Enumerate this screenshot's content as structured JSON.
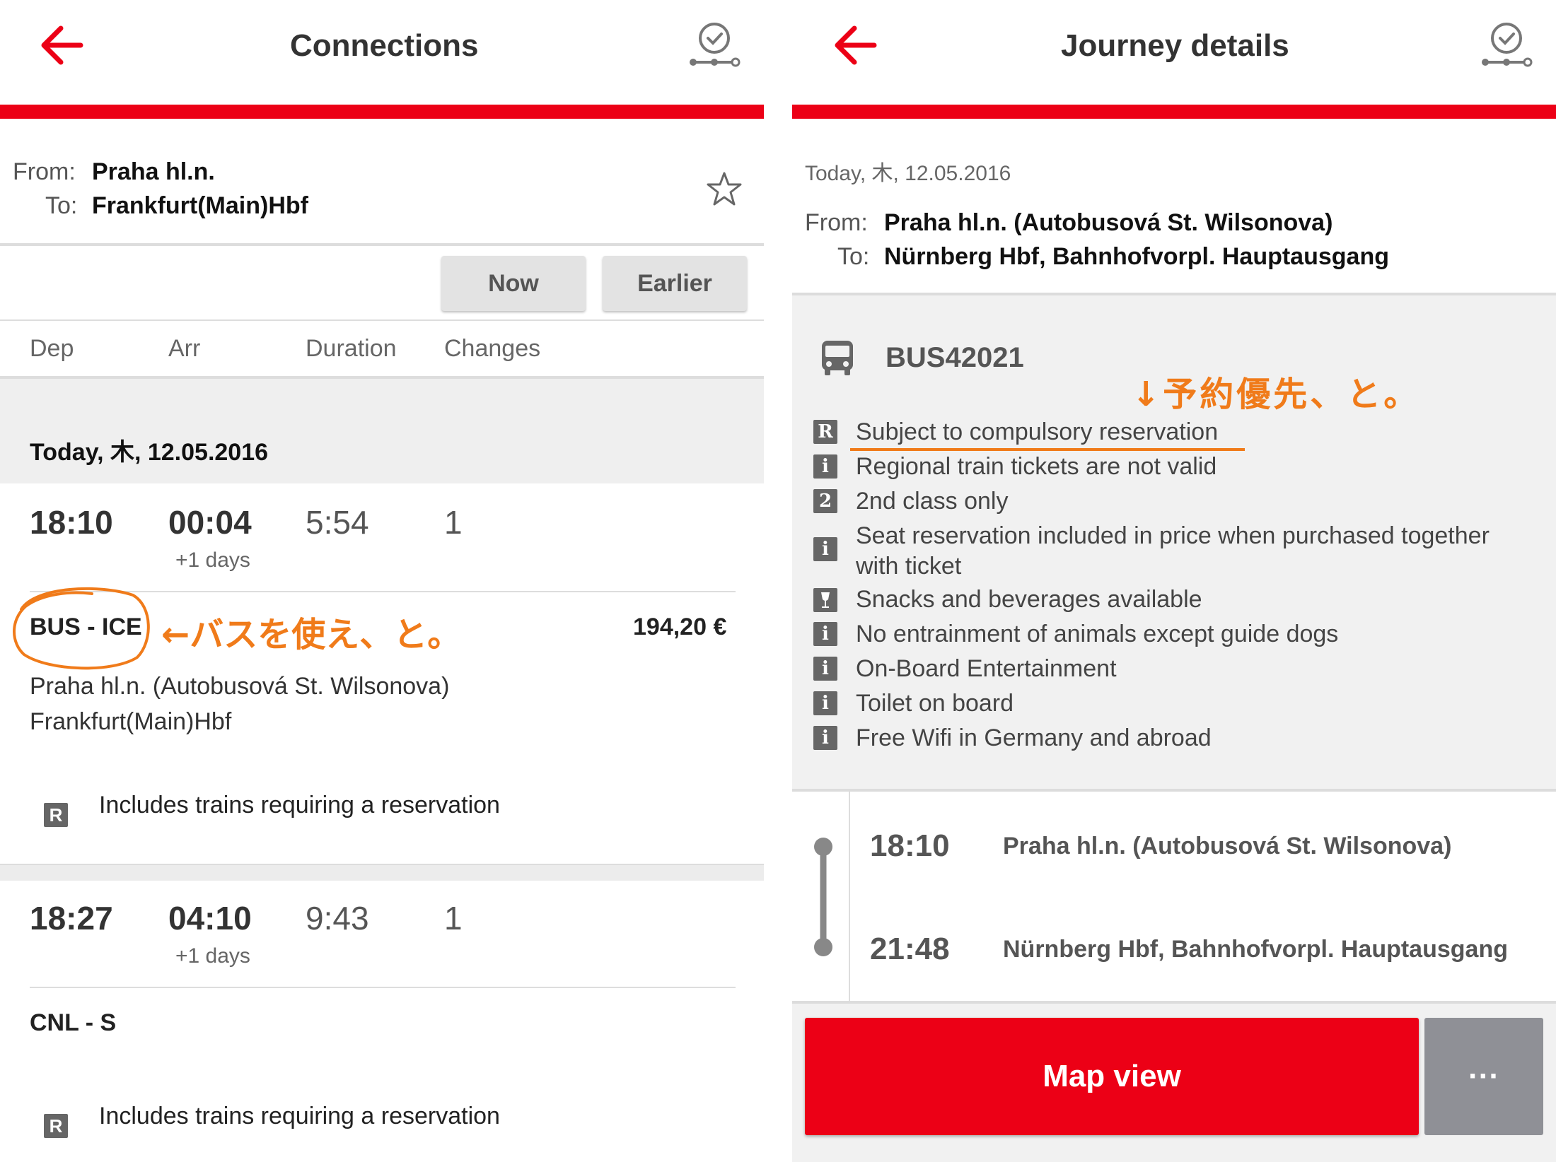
{
  "colors": {
    "brand_red": "#ec0016",
    "annotation_orange": "#f07b1a",
    "badge_gray": "#666666"
  },
  "left": {
    "title": "Connections",
    "from_label": "From:",
    "from_value": "Praha hl.n.",
    "to_label": "To:",
    "to_value": "Frankfurt(Main)Hbf",
    "now_button": "Now",
    "earlier_button": "Earlier",
    "columns": {
      "dep": "Dep",
      "arr": "Arr",
      "duration": "Duration",
      "changes": "Changes"
    },
    "date_header": "Today, 木, 12.05.2016",
    "connections": [
      {
        "dep": "18:10",
        "arr": "00:04",
        "plus_days": "+1 days",
        "duration": "5:54",
        "changes": "1",
        "products": "BUS - ICE",
        "price": "194,20 €",
        "stop1": "Praha hl.n. (Autobusová St. Wilsonova)",
        "stop2": "Frankfurt(Main)Hbf",
        "reservation_badge": "R",
        "reservation_note": "Includes trains requiring a reservation"
      },
      {
        "dep": "18:27",
        "arr": "04:10",
        "plus_days": "+1 days",
        "duration": "9:43",
        "changes": "1",
        "products": "CNL - S",
        "reservation_badge": "R",
        "reservation_note": "Includes trains requiring a reservation"
      }
    ],
    "annotation": "←バスを使え、と。"
  },
  "right": {
    "title": "Journey details",
    "date": "Today, 木, 12.05.2016",
    "from_label": "From:",
    "from_value": "Praha hl.n. (Autobusová St. Wilsonova)",
    "to_label": "To:",
    "to_value": "Nürnberg Hbf, Bahnhofvorpl. Hauptausgang",
    "vehicle": "BUS42021",
    "annotation": "↓予約優先、と。",
    "attributes": [
      {
        "badge": "R",
        "text": "Subject to compulsory reservation"
      },
      {
        "badge": "i",
        "text": "Regional train tickets are not valid"
      },
      {
        "badge": "2",
        "text": "2nd class only"
      },
      {
        "badge": "i",
        "text": "Seat reservation included in price when purchased together",
        "text2": "with ticket"
      },
      {
        "badge": "glass",
        "text": "Snacks and beverages available"
      },
      {
        "badge": "i",
        "text": "No entrainment of animals except guide dogs"
      },
      {
        "badge": "i",
        "text": "On-Board Entertainment"
      },
      {
        "badge": "i",
        "text": "Toilet on board"
      },
      {
        "badge": "i",
        "text": "Free Wifi in Germany and abroad"
      }
    ],
    "stops": [
      {
        "time": "18:10",
        "name": "Praha hl.n. (Autobusová St. Wilsonova)"
      },
      {
        "time": "21:48",
        "name": "Nürnberg Hbf, Bahnhofvorpl. Hauptausgang"
      }
    ],
    "map_button": "Map view",
    "more_button": "···"
  }
}
